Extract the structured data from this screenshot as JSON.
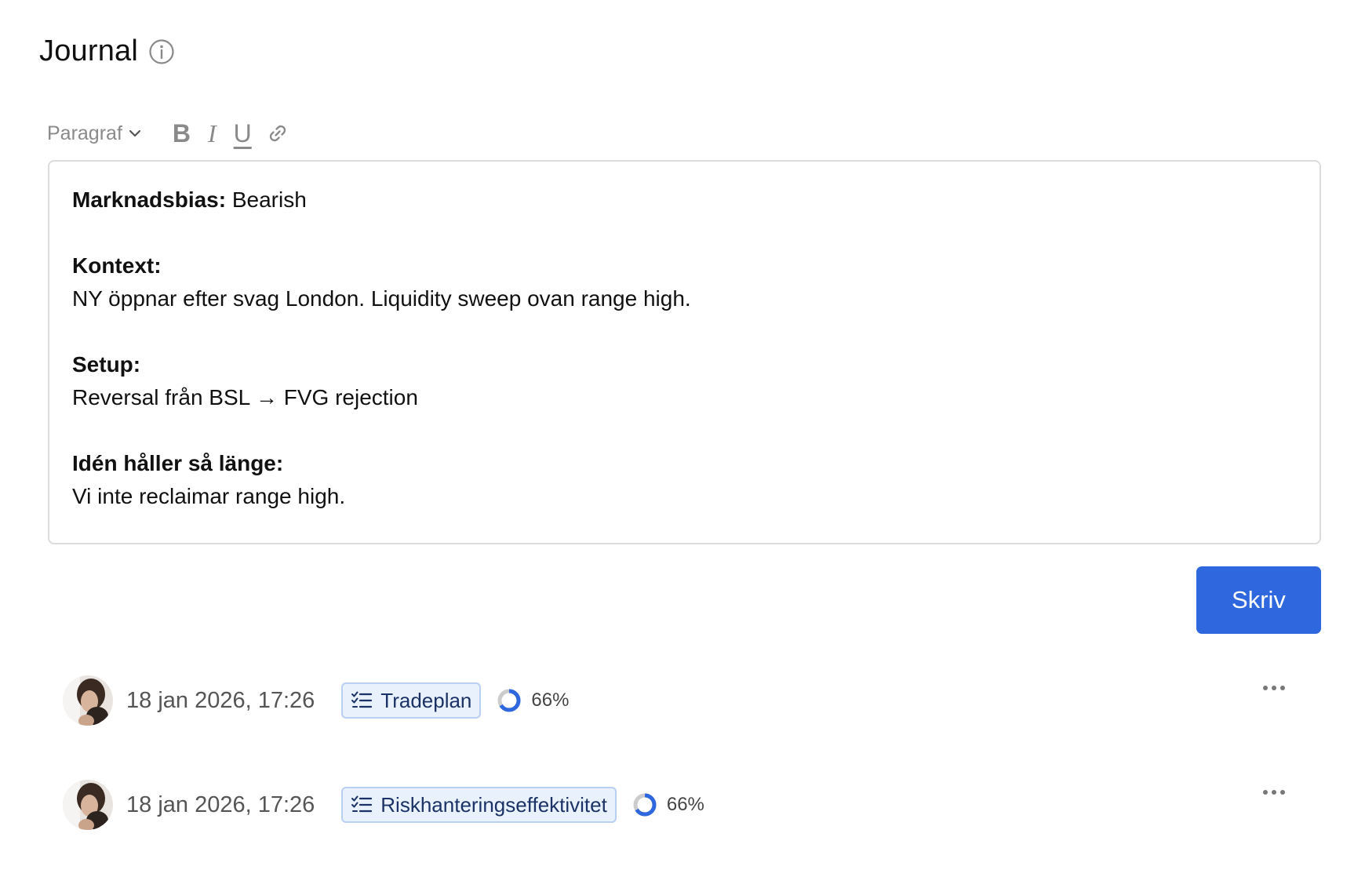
{
  "header": {
    "title": "Journal",
    "info_icon": "info-circle-icon"
  },
  "toolbar": {
    "paragraph_style": "Paragraf",
    "bold_label": "B",
    "italic_label": "I",
    "underline_label": "U",
    "link_icon": "link-icon"
  },
  "editor": {
    "bias_label": "Marknadsbias:",
    "bias_value": "Bearish",
    "context_label": "Kontext:",
    "context_text": "NY öppnar efter svag London. Liquidity sweep ovan range high.",
    "setup_label": "Setup:",
    "setup_text": "Reversal från BSL → FVG rejection",
    "idea_label": "Idén håller så länge:",
    "idea_text": "Vi inte reclaimar range high."
  },
  "submit_button": "Skriv",
  "entries": [
    {
      "timestamp": "18 jan 2026, 17:26",
      "tag_label": "Tradeplan",
      "progress_text": "66%",
      "progress_value": 0.66
    },
    {
      "timestamp": "18 jan 2026, 17:26",
      "tag_label": "Riskhanteringseffektivitet",
      "progress_text": "66%",
      "progress_value": 0.66
    }
  ],
  "colors": {
    "accent": "#2f68de",
    "tag_bg": "#e9f1fd",
    "tag_border": "#b9d0f3",
    "tag_text": "#1b3266",
    "progress_track": "#cccccc"
  }
}
